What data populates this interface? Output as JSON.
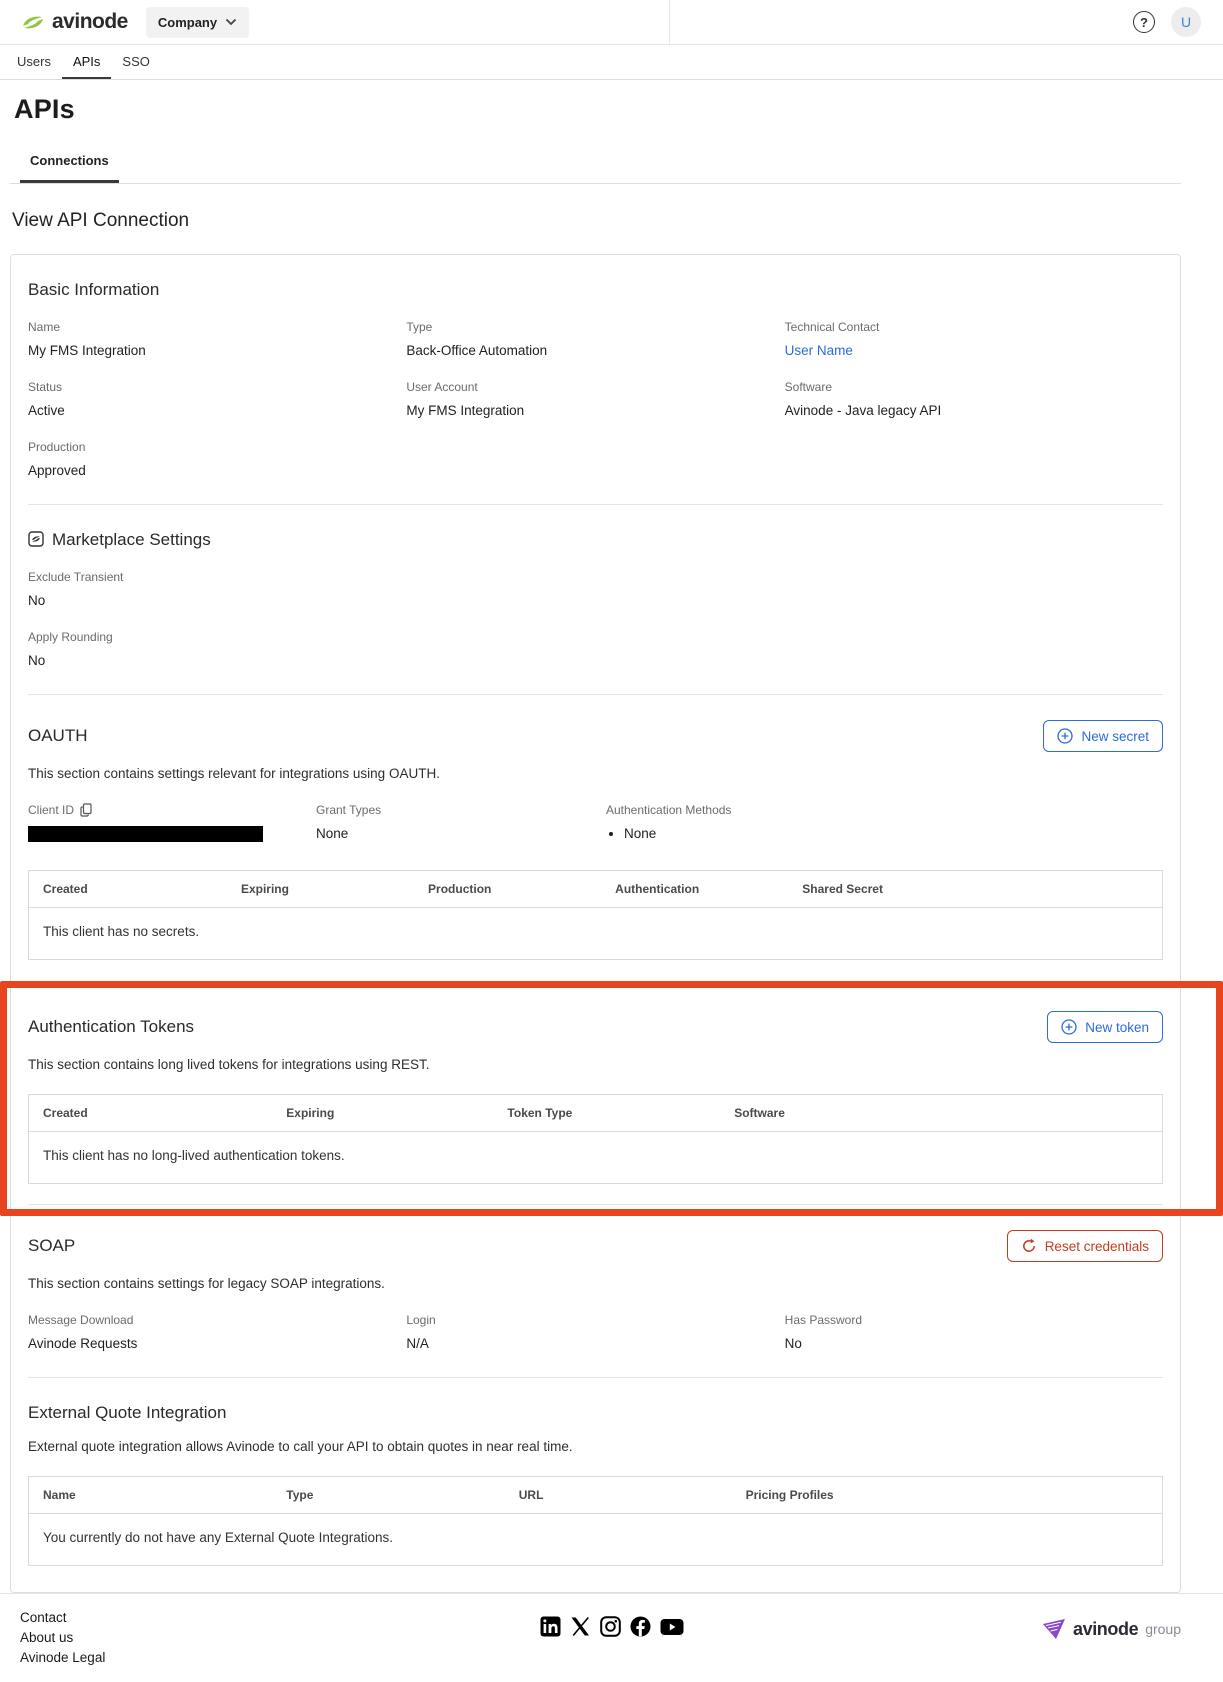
{
  "header": {
    "brand": "avinode",
    "company_button": "Company",
    "avatar_initial": "U"
  },
  "nav_tabs": [
    {
      "label": "Users"
    },
    {
      "label": "APIs"
    },
    {
      "label": "SSO"
    }
  ],
  "page": {
    "title": "APIs",
    "subtab": "Connections",
    "heading": "View API Connection"
  },
  "basic_information": {
    "title": "Basic Information",
    "fields": [
      {
        "label": "Name",
        "value": "My FMS Integration"
      },
      {
        "label": "Type",
        "value": "Back-Office Automation"
      },
      {
        "label": "Technical Contact",
        "value": "User Name"
      },
      {
        "label": "Status",
        "value": "Active"
      },
      {
        "label": "User Account",
        "value": "My FMS Integration"
      },
      {
        "label": "Software",
        "value": "Avinode - Java legacy API"
      },
      {
        "label": "Production",
        "value": "Approved"
      }
    ]
  },
  "marketplace_settings": {
    "title": "Marketplace Settings",
    "fields": [
      {
        "label": "Exclude Transient",
        "value": "No"
      },
      {
        "label": "Apply Rounding",
        "value": "No"
      }
    ]
  },
  "oauth": {
    "title": "OAUTH",
    "description": "This section contains settings relevant for integrations using OAUTH.",
    "button": "New secret",
    "client_id_label": "Client ID",
    "grant_types_label": "Grant Types",
    "grant_types_value": "None",
    "auth_methods_label": "Authentication Methods",
    "auth_methods_value": "None",
    "table": {
      "columns": [
        "Created",
        "Expiring",
        "Production",
        "Authentication",
        "Shared Secret"
      ],
      "empty_message": "This client has no secrets."
    }
  },
  "auth_tokens": {
    "title": "Authentication Tokens",
    "description": "This section contains long lived tokens for integrations using REST.",
    "button": "New token",
    "table": {
      "columns": [
        "Created",
        "Expiring",
        "Token Type",
        "Software"
      ],
      "empty_message": "This client has no long-lived authentication tokens."
    }
  },
  "soap": {
    "title": "SOAP",
    "description": "This section contains settings for legacy SOAP integrations.",
    "button": "Reset credentials",
    "fields": [
      {
        "label": "Message Download",
        "value": "Avinode Requests"
      },
      {
        "label": "Login",
        "value": "N/A"
      },
      {
        "label": "Has Password",
        "value": "No"
      }
    ]
  },
  "external_quote": {
    "title": "External Quote Integration",
    "description": "External quote integration allows Avinode to call your API to obtain quotes in near real time.",
    "table": {
      "columns": [
        "Name",
        "Type",
        "URL",
        "Pricing Profiles"
      ],
      "empty_message": "You currently do not have any External Quote Integrations."
    }
  },
  "footer": {
    "links": [
      "Contact",
      "About us",
      "Avinode Legal"
    ],
    "social_icons": [
      "linkedin",
      "x",
      "instagram",
      "facebook",
      "youtube"
    ],
    "brand": "avinode",
    "brand_suffix": "group"
  },
  "colors": {
    "brand_green": "#8dc63f",
    "accent_blue": "#2b6cd9",
    "highlight_red": "#e8451f",
    "reset_red": "#c23d1e",
    "brand_purple": "#8b46c9"
  }
}
